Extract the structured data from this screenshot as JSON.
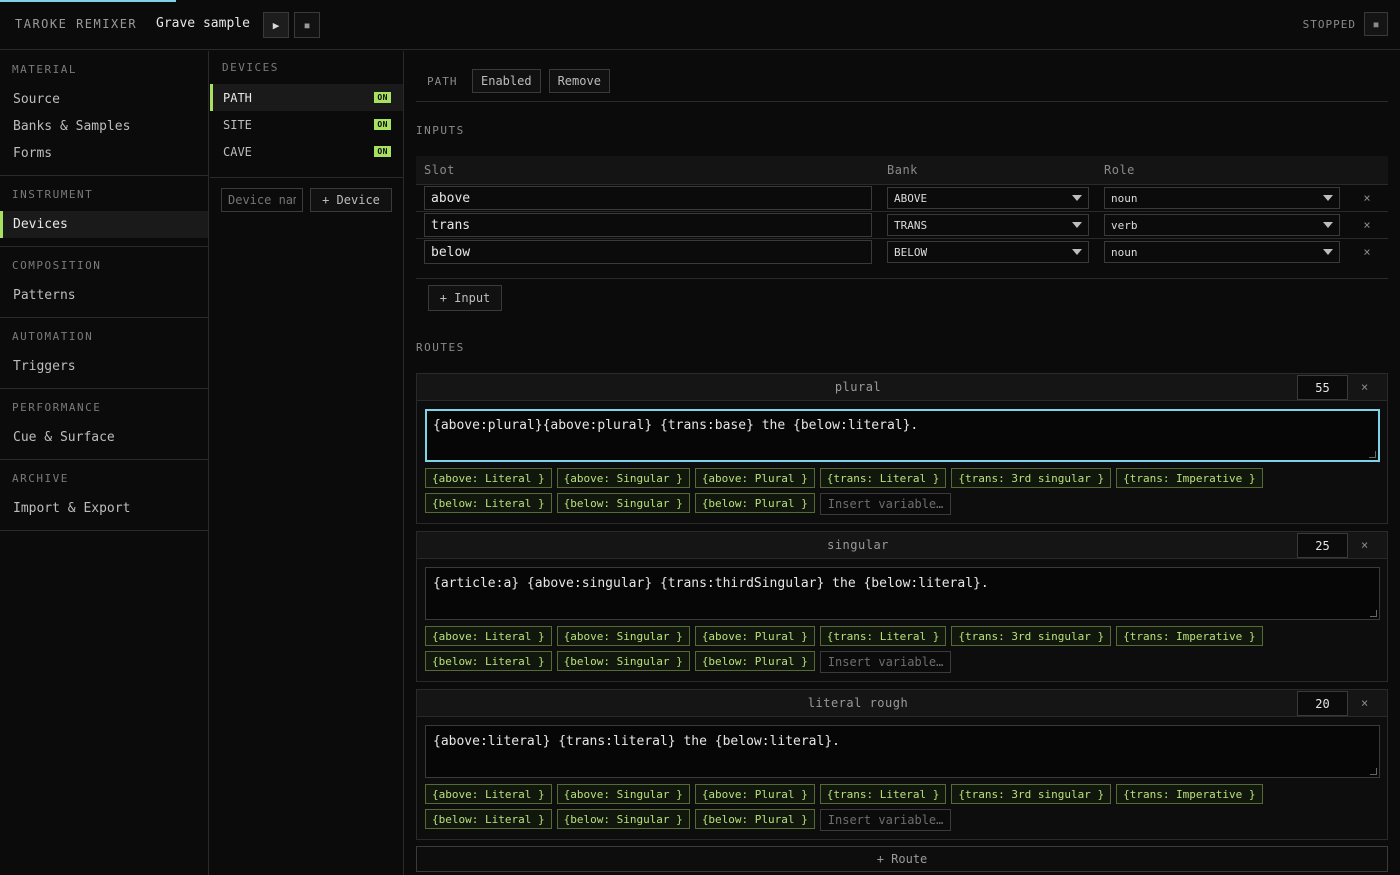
{
  "header": {
    "app_title": "TAROKE REMIXER",
    "sample_name": "Grave sample",
    "play_icon": "▶",
    "stop_icon": "■",
    "status": "STOPPED"
  },
  "sidebar": {
    "sections": [
      {
        "heading": "MATERIAL",
        "items": [
          "Source",
          "Banks & Samples",
          "Forms"
        ]
      },
      {
        "heading": "INSTRUMENT",
        "items": [
          "Devices"
        ]
      },
      {
        "heading": "COMPOSITION",
        "items": [
          "Patterns"
        ]
      },
      {
        "heading": "AUTOMATION",
        "items": [
          "Triggers"
        ]
      },
      {
        "heading": "PERFORMANCE",
        "items": [
          "Cue & Surface"
        ]
      },
      {
        "heading": "ARCHIVE",
        "items": [
          "Import & Export"
        ]
      }
    ]
  },
  "devices": {
    "heading": "DEVICES",
    "items": [
      {
        "name": "PATH",
        "badge": "ON"
      },
      {
        "name": "SITE",
        "badge": "ON"
      },
      {
        "name": "CAVE",
        "badge": "ON"
      }
    ],
    "name_placeholder": "Device name",
    "add_label": "+ Device"
  },
  "path_bar": {
    "label": "PATH",
    "enabled_label": "Enabled",
    "remove_label": "Remove"
  },
  "inputs": {
    "heading": "INPUTS",
    "columns": [
      "Slot",
      "Bank",
      "Role"
    ],
    "rows": [
      {
        "slot": "above",
        "bank": "ABOVE",
        "role": "noun"
      },
      {
        "slot": "trans",
        "bank": "TRANS",
        "role": "verb"
      },
      {
        "slot": "below",
        "bank": "BELOW",
        "role": "noun"
      }
    ],
    "remove_icon": "×",
    "add_label": "+ Input"
  },
  "routes": {
    "heading": "ROUTES",
    "remove_icon": "×",
    "insert_placeholder": "Insert variable…",
    "chips": [
      "{above: Literal }",
      "{above: Singular }",
      "{above: Plural }",
      "{trans: Literal }",
      "{trans: 3rd singular }",
      "{trans: Imperative }",
      "{below: Literal }",
      "{below: Singular }",
      "{below: Plural }"
    ],
    "items": [
      {
        "name": "plural",
        "weight": "55",
        "template": "{above:plural}{above:plural} {trans:base} the {below:literal}."
      },
      {
        "name": "singular",
        "weight": "25",
        "template": "{article:a} {above:singular} {trans:thirdSingular} the {below:literal}."
      },
      {
        "name": "literal rough",
        "weight": "20",
        "template": "{above:literal} {trans:literal} the {below:literal}."
      }
    ],
    "add_label": "+ Route"
  }
}
